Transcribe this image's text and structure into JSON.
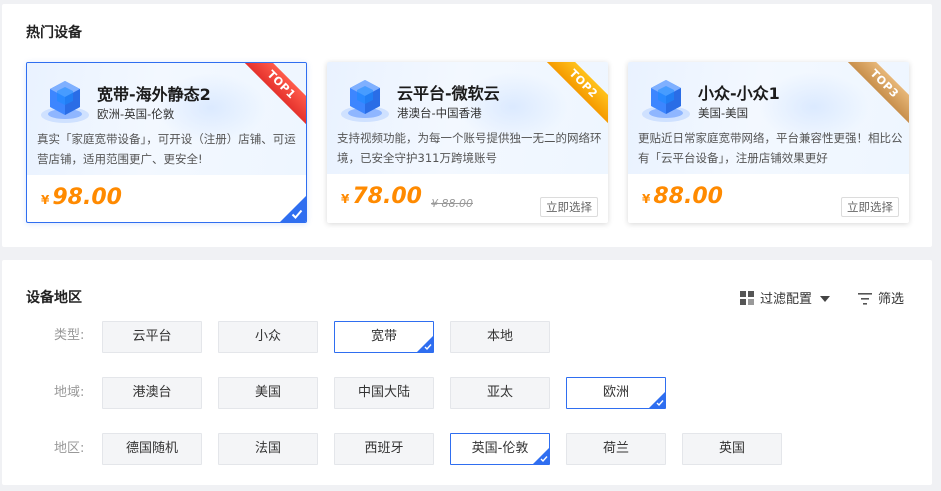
{
  "hot": {
    "title": "热门设备",
    "cards": [
      {
        "rank": "TOP1",
        "name": "宽带-海外静态2",
        "location": "欧洲-英国-伦敦",
        "desc": "真实「家庭宽带设备」，可开设（注册）店铺、可运营店铺，适用范围更广、更安全!",
        "currency": "¥",
        "price": "98.00",
        "selected": true,
        "icon": "server-cube-icon"
      },
      {
        "rank": "TOP2",
        "name": "云平台-微软云",
        "location": "港澳台-中国香港",
        "desc": "支持视频功能，为每一个账号提供独一无二的网络环境，已安全守护311万跨境账号",
        "currency": "¥",
        "price": "78.00",
        "old_price": "¥ 88.00",
        "button": "立即选择",
        "selected": false,
        "icon": "server-cube-icon"
      },
      {
        "rank": "TOP3",
        "name": "小众-小众1",
        "location": "美国-美国",
        "desc": "更贴近日常家庭宽带网络，平台兼容性更强！相比公有「云平台设备」，注册店铺效果更好",
        "currency": "¥",
        "price": "88.00",
        "button": "立即选择",
        "selected": false,
        "icon": "server-cube-icon"
      }
    ],
    "colors": {
      "accent": "#2f6ef0",
      "price": "#ff8a00",
      "top1": "#e5322d",
      "top2": "#f59a00",
      "top3": "#c88f4c"
    }
  },
  "region": {
    "title": "设备地区",
    "filter_config_label": "过滤配置",
    "filter_label": "筛选",
    "rows": [
      {
        "label": "类型:",
        "options": [
          "云平台",
          "小众",
          "宽带",
          "本地"
        ],
        "selected": "宽带"
      },
      {
        "label": "地域:",
        "options": [
          "港澳台",
          "美国",
          "中国大陆",
          "亚太",
          "欧洲"
        ],
        "selected": "欧洲"
      },
      {
        "label": "地区:",
        "options": [
          "德国随机",
          "法国",
          "西班牙",
          "英国-伦敦",
          "荷兰",
          "英国"
        ],
        "selected": "英国-伦敦"
      }
    ]
  }
}
